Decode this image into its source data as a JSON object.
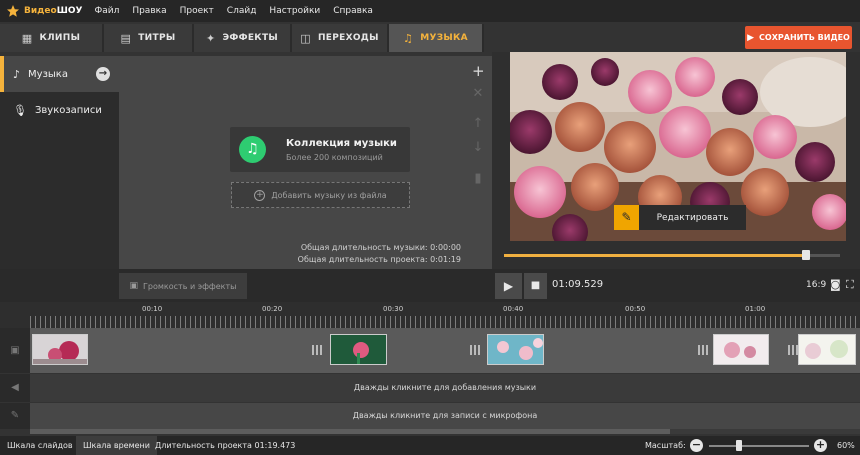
{
  "menubar": {
    "logo_part1": "Видео",
    "logo_part2": "ШОУ",
    "items": [
      "Файл",
      "Правка",
      "Проект",
      "Слайд",
      "Настройки",
      "Справка"
    ]
  },
  "tabs": [
    {
      "label": "КЛИПЫ",
      "icon": "film-icon"
    },
    {
      "label": "ТИТРЫ",
      "icon": "text-icon"
    },
    {
      "label": "ЭФФЕКТЫ",
      "icon": "effects-icon"
    },
    {
      "label": "ПЕРЕХОДЫ",
      "icon": "transitions-icon"
    },
    {
      "label": "МУЗЫКА",
      "icon": "music-note-icon",
      "active": true
    }
  ],
  "sidebar": {
    "items": [
      {
        "label": "Музыка",
        "icon": "music-icon",
        "active": true
      },
      {
        "label": "Звукозаписи",
        "icon": "microphone-icon"
      }
    ]
  },
  "music": {
    "collection_title": "Коллекция музыки",
    "collection_subtitle": "Более 200 композиций",
    "add_file_label": "Добавить музыку из файла",
    "music_duration": "Общая длительность музыки: 0:00:00",
    "project_duration": "Общая длительность проекта: 0:01:19"
  },
  "preview": {
    "save_label": "СОХРАНИТЬ ВИДЕО",
    "edit_label": "Редактировать",
    "seek_fraction": 0.9
  },
  "controls": {
    "volume_label": "Громкость и эффекты",
    "time": "01:09.529",
    "ratio": "16:9"
  },
  "ruler": {
    "labels": [
      "00:10",
      "00:20",
      "00:30",
      "00:40",
      "00:50",
      "01:00"
    ]
  },
  "timeline": {
    "music_hint": "Дважды кликните для добавления музыки",
    "mic_hint": "Дважды кликните для записи с микрофона"
  },
  "status": {
    "tab_slides": "Шкала слайдов",
    "tab_timeline": "Шкала времени",
    "project_duration": "Длительность проекта 01:19.473",
    "zoom_label": "Масштаб:",
    "zoom_percent": "60%",
    "zoom_fraction": 0.3
  },
  "colors": {
    "accent": "#f5b33c",
    "save_button": "#e8552f",
    "music_icon": "#2ecc71"
  }
}
